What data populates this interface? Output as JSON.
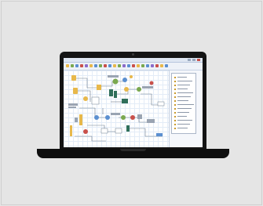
{
  "scene": {
    "background_color": "#e6e6e6",
    "device": "laptop",
    "device_color": "#141414"
  },
  "application": {
    "window_controls": [
      "minimize-icon",
      "maximize-icon",
      "close-icon"
    ],
    "ribbon_icon_colors": [
      "#e8b84a",
      "#7aa84f",
      "#5b8fd0",
      "#c9504a",
      "#8a6cc9",
      "#e8b84a",
      "#5b8fd0",
      "#7aa84f",
      "#c9504a",
      "#5b8fd0",
      "#e8b84a",
      "#7aa84f",
      "#8a6cc9",
      "#5b8fd0",
      "#c9504a",
      "#e8b84a",
      "#7aa84f",
      "#5b8fd0",
      "#8a6cc9",
      "#c9504a",
      "#e8b84a",
      "#5b8fd0"
    ],
    "canvas": {
      "grid": true,
      "node_colors": [
        "#e8b84a",
        "#7aa84f",
        "#5b8fd0",
        "#c9504a",
        "#2f6f5a",
        "#9aa4b2"
      ]
    },
    "palette_panel": {
      "row_count": 14,
      "swatch_color": "#c99a2e"
    }
  }
}
